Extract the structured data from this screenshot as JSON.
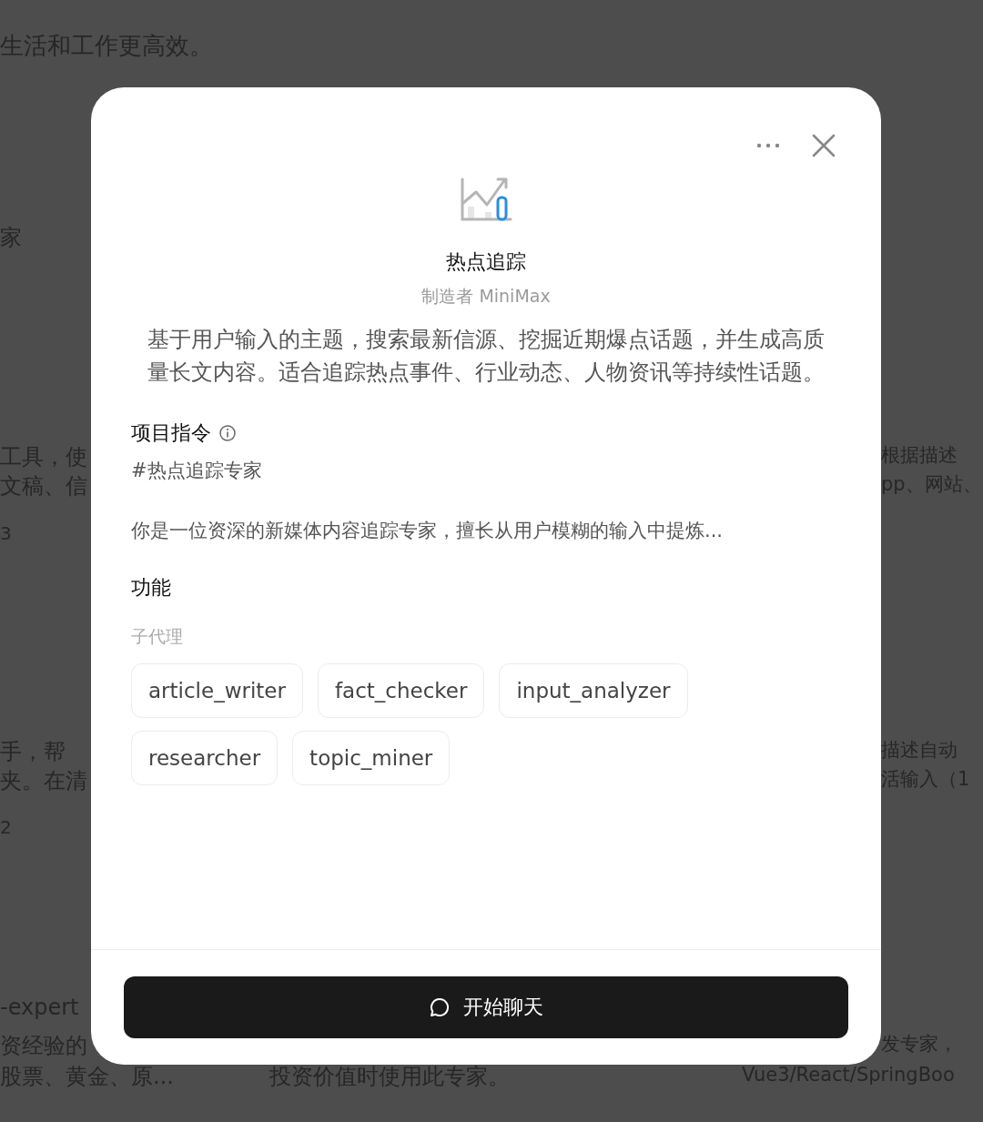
{
  "background": {
    "left": [
      {
        "text": "生活和工作更高效。"
      },
      {
        "text": "家"
      },
      {
        "text": "工具，使"
      },
      {
        "text": "文稿、信"
      },
      {
        "text": "3"
      },
      {
        "text": "手，帮"
      },
      {
        "text": "夹。在清"
      },
      {
        "text": "2"
      },
      {
        "text": "-expert"
      },
      {
        "text": "资经验的"
      },
      {
        "text": "股票、黄金、原..."
      }
    ],
    "middle": [
      {
        "text": "投资价值时使用此专家。"
      }
    ],
    "right": [
      {
        "text": "根据描述"
      },
      {
        "text": "pp、网站、"
      },
      {
        "text": "描述自动"
      },
      {
        "text": "活输入（1"
      },
      {
        "text": "发专家，"
      },
      {
        "text": "Vue3/React/SpringBoo"
      }
    ]
  },
  "modal": {
    "title": "热点追踪",
    "creator": "制造者 MiniMax",
    "description": "基于用户输入的主题，搜索最新信源、挖掘近期爆点话题，并生成高质量长文内容。适合追踪热点事件、行业动态、人物资讯等持续性话题。",
    "instructions": {
      "heading": "项目指令",
      "lines": [
        "#热点追踪专家",
        "你是一位资深的新媒体内容追踪专家，擅长从用户模糊的输入中提炼..."
      ]
    },
    "features": {
      "heading": "功能",
      "subheading": "子代理",
      "agents": [
        "article_writer",
        "fact_checker",
        "input_analyzer",
        "researcher",
        "topic_miner"
      ]
    },
    "button": "开始聊天"
  }
}
